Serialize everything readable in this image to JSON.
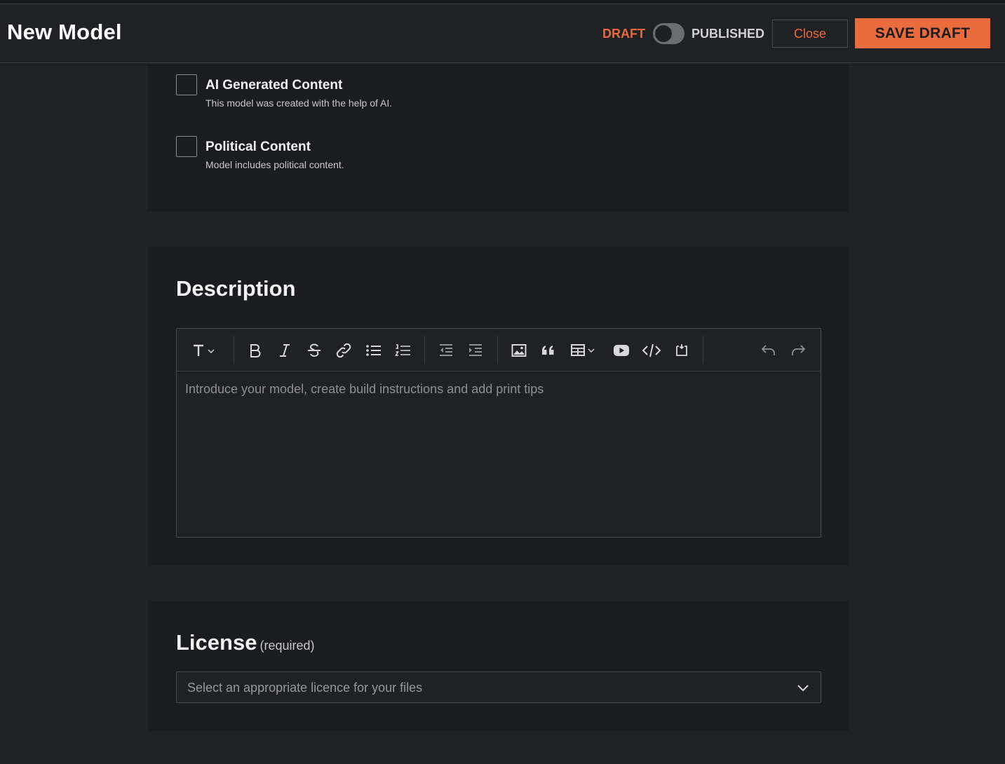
{
  "header": {
    "title": "New Model",
    "status_draft": "DRAFT",
    "status_published": "PUBLISHED",
    "close_label": "Close",
    "save_label": "SAVE DRAFT",
    "accent_color": "#ea6b3c"
  },
  "flags": {
    "ai": {
      "label": "AI Generated Content",
      "help": "This model was created with the help of AI.",
      "checked": false
    },
    "political": {
      "label": "Political Content",
      "help": "Model includes political content.",
      "checked": false
    }
  },
  "description": {
    "title": "Description",
    "placeholder": "Introduce your model, create build instructions and add print tips",
    "toolbar": [
      "text-style-icon",
      "bold-icon",
      "italic-icon",
      "strikethrough-icon",
      "link-icon",
      "bullet-list-icon",
      "numbered-list-icon",
      "outdent-icon",
      "indent-icon",
      "image-icon",
      "quote-icon",
      "table-icon",
      "video-icon",
      "code-icon",
      "embed-icon",
      "undo-icon",
      "redo-icon"
    ]
  },
  "license": {
    "title": "License",
    "required": "(required)",
    "placeholder": "Select an appropriate licence for your files"
  }
}
